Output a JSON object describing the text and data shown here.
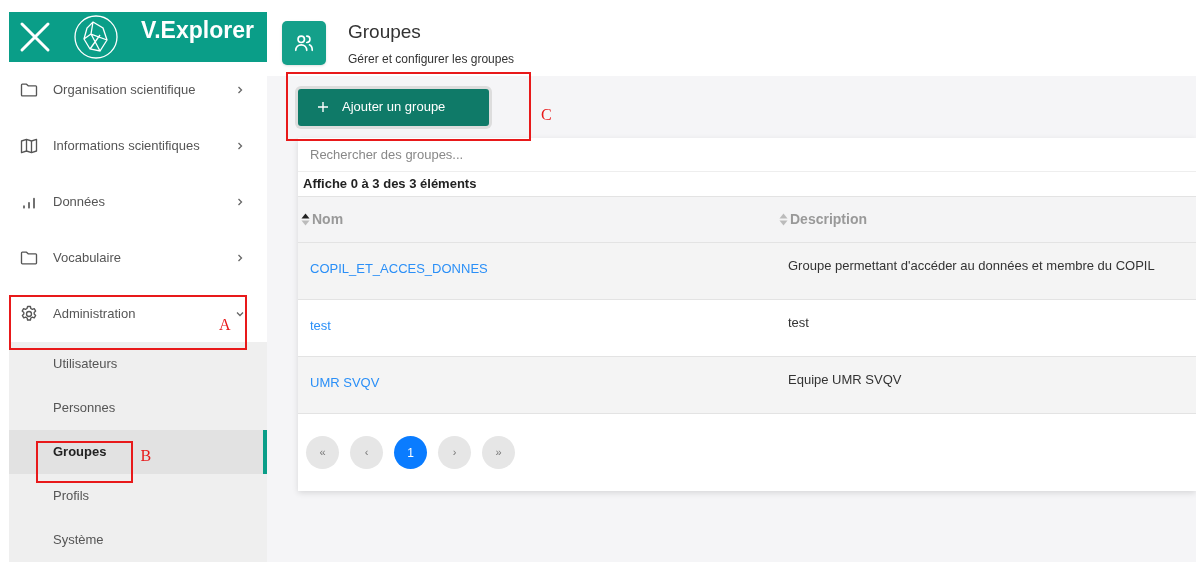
{
  "brand": "V.Explorer",
  "menu": [
    {
      "label": "Organisation scientifique",
      "kind": "folder",
      "expanded": false
    },
    {
      "label": "Informations scientifiques",
      "kind": "map",
      "expanded": false
    },
    {
      "label": "Données",
      "kind": "chart",
      "expanded": false
    },
    {
      "label": "Vocabulaire",
      "kind": "folder",
      "expanded": false
    },
    {
      "label": "Administration",
      "kind": "settings",
      "expanded": true,
      "children": [
        {
          "label": "Utilisateurs",
          "selected": false
        },
        {
          "label": "Personnes",
          "selected": false
        },
        {
          "label": "Groupes",
          "selected": true
        },
        {
          "label": "Profils",
          "selected": false
        },
        {
          "label": "Système",
          "selected": false
        }
      ]
    }
  ],
  "page": {
    "title": "Groupes",
    "subtitle": "Gérer et configurer les groupes"
  },
  "add_button": {
    "label": "Ajouter un groupe"
  },
  "search": {
    "placeholder": "Rechercher des groupes..."
  },
  "count": "Affiche 0 à 3 des 3 éléments",
  "table": {
    "columns": [
      {
        "label": "Nom",
        "sorted": true
      },
      {
        "label": "Description",
        "sorted": false
      }
    ],
    "rows": [
      {
        "name": "COPIL_ET_ACCES_DONNES",
        "description": "Groupe permettant d'accéder au données et membre du COPIL"
      },
      {
        "name": "test",
        "description": "test"
      },
      {
        "name": "UMR SVQV",
        "description": "Equipe UMR SVQV"
      }
    ]
  },
  "pagination": [
    {
      "label": "«",
      "selected": false
    },
    {
      "label": "‹",
      "selected": false
    },
    {
      "label": "1",
      "selected": true
    },
    {
      "label": "›",
      "selected": false
    },
    {
      "label": "»",
      "selected": false
    }
  ],
  "annotations": [
    {
      "label": "A"
    },
    {
      "label": "B"
    },
    {
      "label": "C"
    }
  ]
}
